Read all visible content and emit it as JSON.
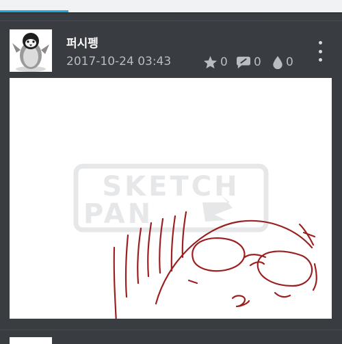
{
  "post": {
    "username": "퍼시펭",
    "timestamp": "2017-10-24 03:43",
    "stats": {
      "stars": "0",
      "comments": "0",
      "drops": "0"
    },
    "watermark": [
      "SKETCH",
      "PAN"
    ]
  },
  "colors": {
    "background": "#393c40",
    "accent": "#1ba7e0",
    "drawing_stroke": "#9c1f1f",
    "watermark": "#e6e7e9"
  },
  "icons": {
    "stars": "star-icon",
    "comments": "comment-icon",
    "drops": "drop-icon",
    "menu": "more-vertical-icon"
  }
}
